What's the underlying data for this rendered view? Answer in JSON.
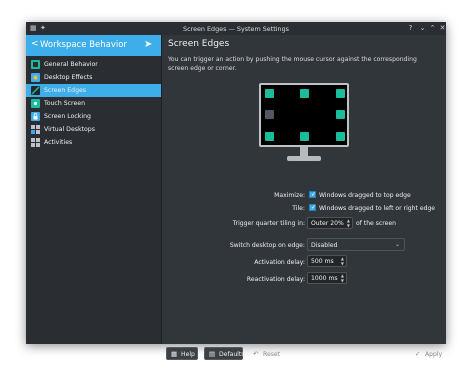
{
  "window": {
    "title": "Screen Edges — System Settings",
    "help_glyph": "?",
    "minimize_glyph": "⌄",
    "maximize_glyph": "⌃",
    "close_glyph": "✕",
    "pin_glyph": "✦"
  },
  "sidebar": {
    "header": "Workspace Behavior",
    "back_glyph": "<",
    "items": [
      {
        "label": "General Behavior",
        "icon": "general-behavior-icon",
        "active": false
      },
      {
        "label": "Desktop Effects",
        "icon": "desktop-effects-icon",
        "active": false
      },
      {
        "label": "Screen Edges",
        "icon": "screen-edges-icon",
        "active": true
      },
      {
        "label": "Touch Screen",
        "icon": "touch-screen-icon",
        "active": false
      },
      {
        "label": "Screen Locking",
        "icon": "screen-locking-icon",
        "active": false
      },
      {
        "label": "Virtual Desktops",
        "icon": "virtual-desktops-icon",
        "active": false
      },
      {
        "label": "Activities",
        "icon": "activities-icon",
        "active": false
      }
    ]
  },
  "main": {
    "title": "Screen Edges",
    "description": "You can trigger an action by pushing the mouse cursor against the corresponding screen edge or corner.",
    "options": {
      "maximize_label": "Maximize:",
      "maximize_check": "Windows dragged to top edge",
      "maximize_checked": true,
      "tile_label": "Tile:",
      "tile_check": "Windows dragged to left or right edge",
      "tile_checked": true,
      "quarter_label": "Trigger quarter tiling in:",
      "quarter_value": "Outer 20%",
      "quarter_suffix": "of the screen",
      "switch_label": "Switch desktop on edge:",
      "switch_value": "Disabled",
      "activation_label": "Activation delay:",
      "activation_value": "500 ms",
      "reactivation_label": "Reactivation delay:",
      "reactivation_value": "1000 ms"
    }
  },
  "buttons": {
    "help": "Help",
    "defaults": "Defaults",
    "reset": "Reset",
    "apply": "Apply"
  },
  "colors": {
    "accent": "#3daee9",
    "window_bg": "#31363b",
    "sidebar_bg": "#2a2e32",
    "edge_active": "#1abc9c",
    "edge_inactive": "#53585e"
  }
}
